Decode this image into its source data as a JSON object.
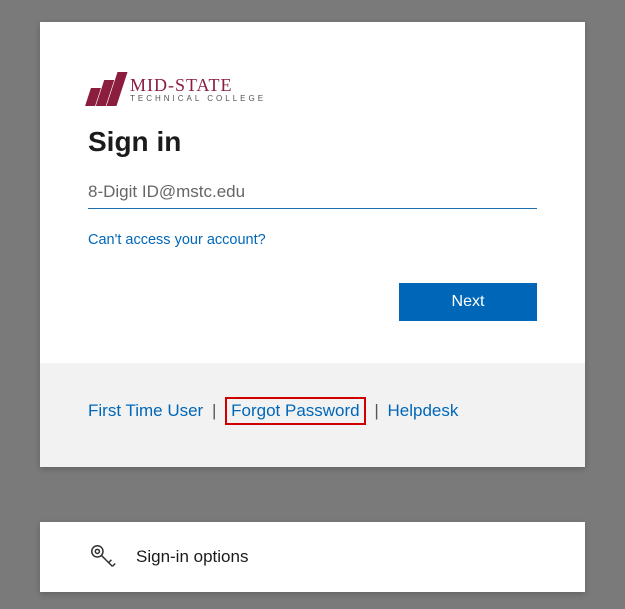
{
  "logo": {
    "main": "MID-STATE",
    "sub": "TECHNICAL COLLEGE"
  },
  "heading": "Sign in",
  "input": {
    "placeholder": "8-Digit ID@mstc.edu",
    "value": ""
  },
  "links": {
    "cant_access": "Can't access your account?"
  },
  "buttons": {
    "next": "Next"
  },
  "footer": {
    "first_time": "First Time User",
    "forgot": "Forgot Password",
    "helpdesk": "Helpdesk",
    "sep": "|"
  },
  "options": {
    "label": "Sign-in options"
  }
}
